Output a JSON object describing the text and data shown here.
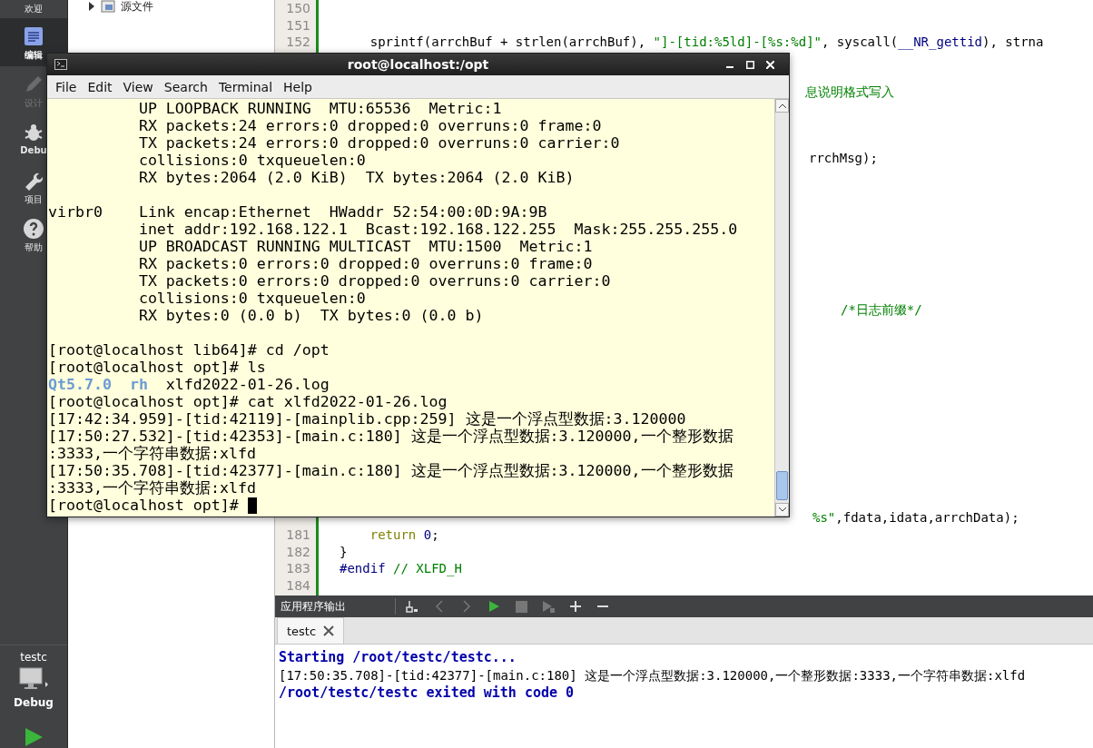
{
  "sidebar": {
    "modes": [
      {
        "label": "欢迎",
        "kind": "welcome",
        "selected": false,
        "disabled": false
      },
      {
        "label": "编辑",
        "kind": "edit",
        "selected": true,
        "disabled": false
      },
      {
        "label": "设计",
        "kind": "design",
        "selected": false,
        "disabled": true
      },
      {
        "label": "Debu",
        "kind": "debug",
        "selected": false,
        "disabled": false
      },
      {
        "label": "项目",
        "kind": "projects",
        "selected": false,
        "disabled": false
      },
      {
        "label": "帮助",
        "kind": "help",
        "selected": false,
        "disabled": false
      }
    ],
    "kit": {
      "project": "testc",
      "build": "Debug"
    }
  },
  "project_tree": {
    "items": [
      {
        "label": "源文件",
        "expanded": false
      }
    ]
  },
  "editor": {
    "top_lines": [
      {
        "number": "150"
      },
      {
        "number": "151"
      },
      {
        "number": "152",
        "indented": true,
        "tokens": [
          {
            "text": "sprintf(arrchBuf + strlen(arrchBuf), ",
            "kind": "plain"
          },
          {
            "text": "\"]-[tid:%5ld]-[%s:%d]\"",
            "kind": "string"
          },
          {
            "text": ", syscall(",
            "kind": "plain"
          },
          {
            "text": "__NR_gettid",
            "kind": "macro"
          },
          {
            "text": "), strna",
            "kind": "plain"
          }
        ]
      }
    ],
    "fragments": [
      {
        "tokens": [
          {
            "text": "息说明格式写入",
            "kind": "comment"
          }
        ]
      },
      {
        "tokens": [
          {
            "text": "rrchMsg);",
            "kind": "plain"
          }
        ]
      },
      {
        "tokens": [
          {
            "text": "/*日志前缀*/",
            "kind": "comment"
          }
        ]
      },
      {
        "tokens": [
          {
            "text": "%s\"",
            "kind": "string"
          },
          {
            "text": ",fdata,idata,arrchData);",
            "kind": "plain"
          }
        ]
      }
    ],
    "bottom_lines": [
      {
        "number": "181",
        "indented": true,
        "tokens": [
          {
            "text": "return",
            "kind": "keyword"
          },
          {
            "text": " 0",
            "kind": "number"
          },
          {
            "text": ";",
            "kind": "plain"
          }
        ]
      },
      {
        "number": "182",
        "tokens": [
          {
            "text": "}",
            "kind": "plain"
          }
        ]
      },
      {
        "number": "183",
        "tokens": [
          {
            "text": "#endif",
            "kind": "macro"
          },
          {
            "text": " // XLFD_H",
            "kind": "comment"
          }
        ]
      },
      {
        "number": "184"
      }
    ]
  },
  "output_pane": {
    "title": "应用程序输出",
    "toolbar": [
      {
        "kind": "clear",
        "disabled": false
      },
      {
        "kind": "prev",
        "disabled": true
      },
      {
        "kind": "next",
        "disabled": true
      },
      {
        "kind": "run",
        "disabled": false
      },
      {
        "kind": "stop",
        "disabled": true
      },
      {
        "kind": "attach",
        "disabled": true
      },
      {
        "kind": "zoom-in",
        "disabled": false
      },
      {
        "kind": "zoom-out",
        "disabled": false
      }
    ],
    "tabs": [
      {
        "label": "testc",
        "selected": true
      }
    ],
    "lines": [
      {
        "kind": "status",
        "text": "Starting /root/testc/testc..."
      },
      {
        "kind": "normal",
        "text": "[17:50:35.708]-[tid:42377]-[main.c:180] 这是一个浮点型数据:3.120000,一个整形数据:3333,一个字符串数据:xlfd"
      },
      {
        "kind": "status",
        "text": "/root/testc/testc exited with code 0"
      }
    ]
  },
  "terminal": {
    "title": "root@localhost:/opt",
    "menu": [
      "File",
      "Edit",
      "View",
      "Search",
      "Terminal",
      "Help"
    ],
    "rows": [
      {
        "kind": "text",
        "indented": true,
        "text": "UP LOOPBACK RUNNING  MTU:65536  Metric:1"
      },
      {
        "kind": "text",
        "indented": true,
        "text": "RX packets:24 errors:0 dropped:0 overruns:0 frame:0"
      },
      {
        "kind": "text",
        "indented": true,
        "text": "TX packets:24 errors:0 dropped:0 overruns:0 carrier:0"
      },
      {
        "kind": "text",
        "indented": true,
        "text": "collisions:0 txqueuelen:0"
      },
      {
        "kind": "text",
        "indented": true,
        "text": "RX bytes:2064 (2.0 KiB)  TX bytes:2064 (2.0 KiB)"
      },
      {
        "kind": "blank"
      },
      {
        "kind": "text",
        "indented": false,
        "text": "virbr0    Link encap:Ethernet  HWaddr 52:54:00:0D:9A:9B"
      },
      {
        "kind": "text",
        "indented": true,
        "text": "inet addr:192.168.122.1  Bcast:192.168.122.255  Mask:255.255.255.0"
      },
      {
        "kind": "text",
        "indented": true,
        "text": "UP BROADCAST RUNNING MULTICAST  MTU:1500  Metric:1"
      },
      {
        "kind": "text",
        "indented": true,
        "text": "RX packets:0 errors:0 dropped:0 overruns:0 frame:0"
      },
      {
        "kind": "text",
        "indented": true,
        "text": "TX packets:0 errors:0 dropped:0 overruns:0 carrier:0"
      },
      {
        "kind": "text",
        "indented": true,
        "text": "collisions:0 txqueuelen:0"
      },
      {
        "kind": "text",
        "indented": true,
        "text": "RX bytes:0 (0.0 b)  TX bytes:0 (0.0 b)"
      },
      {
        "kind": "blank"
      },
      {
        "kind": "text",
        "indented": false,
        "text": "[root@localhost lib64]# cd /opt"
      },
      {
        "kind": "text",
        "indented": false,
        "text": "[root@localhost opt]# ls"
      },
      {
        "kind": "listing",
        "entries": [
          {
            "text": "Qt5.7.0",
            "kind": "dir"
          },
          {
            "text": "rh",
            "kind": "dir"
          },
          {
            "text": "xlfd2022-01-26.log",
            "kind": "file"
          }
        ]
      },
      {
        "kind": "text",
        "indented": false,
        "text": "[root@localhost opt]# cat xlfd2022-01-26.log"
      },
      {
        "kind": "text",
        "indented": false,
        "text": "[17:42:34.959]-[tid:42119]-[mainplib.cpp:259] 这是一个浮点型数据:3.120000"
      },
      {
        "kind": "text",
        "indented": false,
        "text": "[17:50:27.532]-[tid:42353]-[main.c:180] 这是一个浮点型数据:3.120000,一个整形数据"
      },
      {
        "kind": "text",
        "indented": false,
        "text": ":3333,一个字符串数据:xlfd"
      },
      {
        "kind": "text",
        "indented": false,
        "text": "[17:50:35.708]-[tid:42377]-[main.c:180] 这是一个浮点型数据:3.120000,一个整形数据"
      },
      {
        "kind": "text",
        "indented": false,
        "text": ":3333,一个字符串数据:xlfd"
      },
      {
        "kind": "prompt",
        "text": "[root@localhost opt]#"
      }
    ]
  }
}
